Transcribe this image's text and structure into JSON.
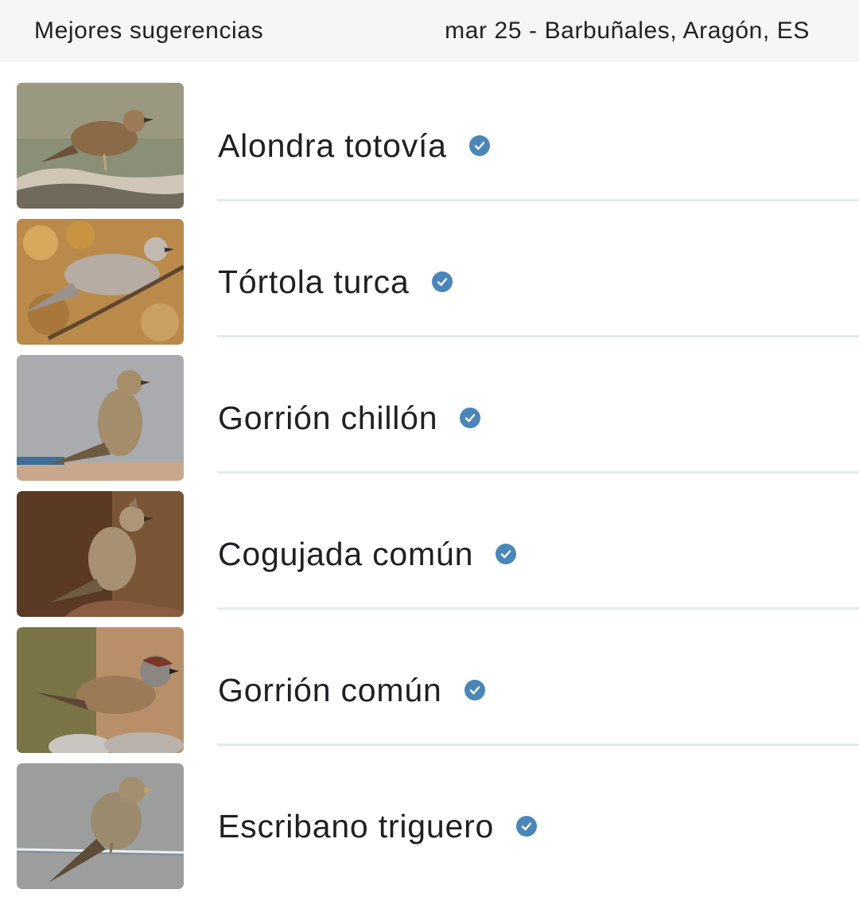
{
  "header": {
    "title": "Mejores sugerencias",
    "date_location": "mar 25 - Barbuñales, Aragón, ES"
  },
  "suggestions": [
    {
      "name": "Alondra totovía",
      "icon": "verified-check-icon"
    },
    {
      "name": "Tórtola turca",
      "icon": "verified-check-icon"
    },
    {
      "name": "Gorrión chillón",
      "icon": "verified-check-icon"
    },
    {
      "name": "Cogujada común",
      "icon": "verified-check-icon"
    },
    {
      "name": "Gorrión común",
      "icon": "verified-check-icon"
    },
    {
      "name": "Escribano triguero",
      "icon": "verified-check-icon"
    }
  ],
  "colors": {
    "header_bg": "#f5f6f6",
    "check": "#4a86b8",
    "divider": "#e4eaea"
  }
}
